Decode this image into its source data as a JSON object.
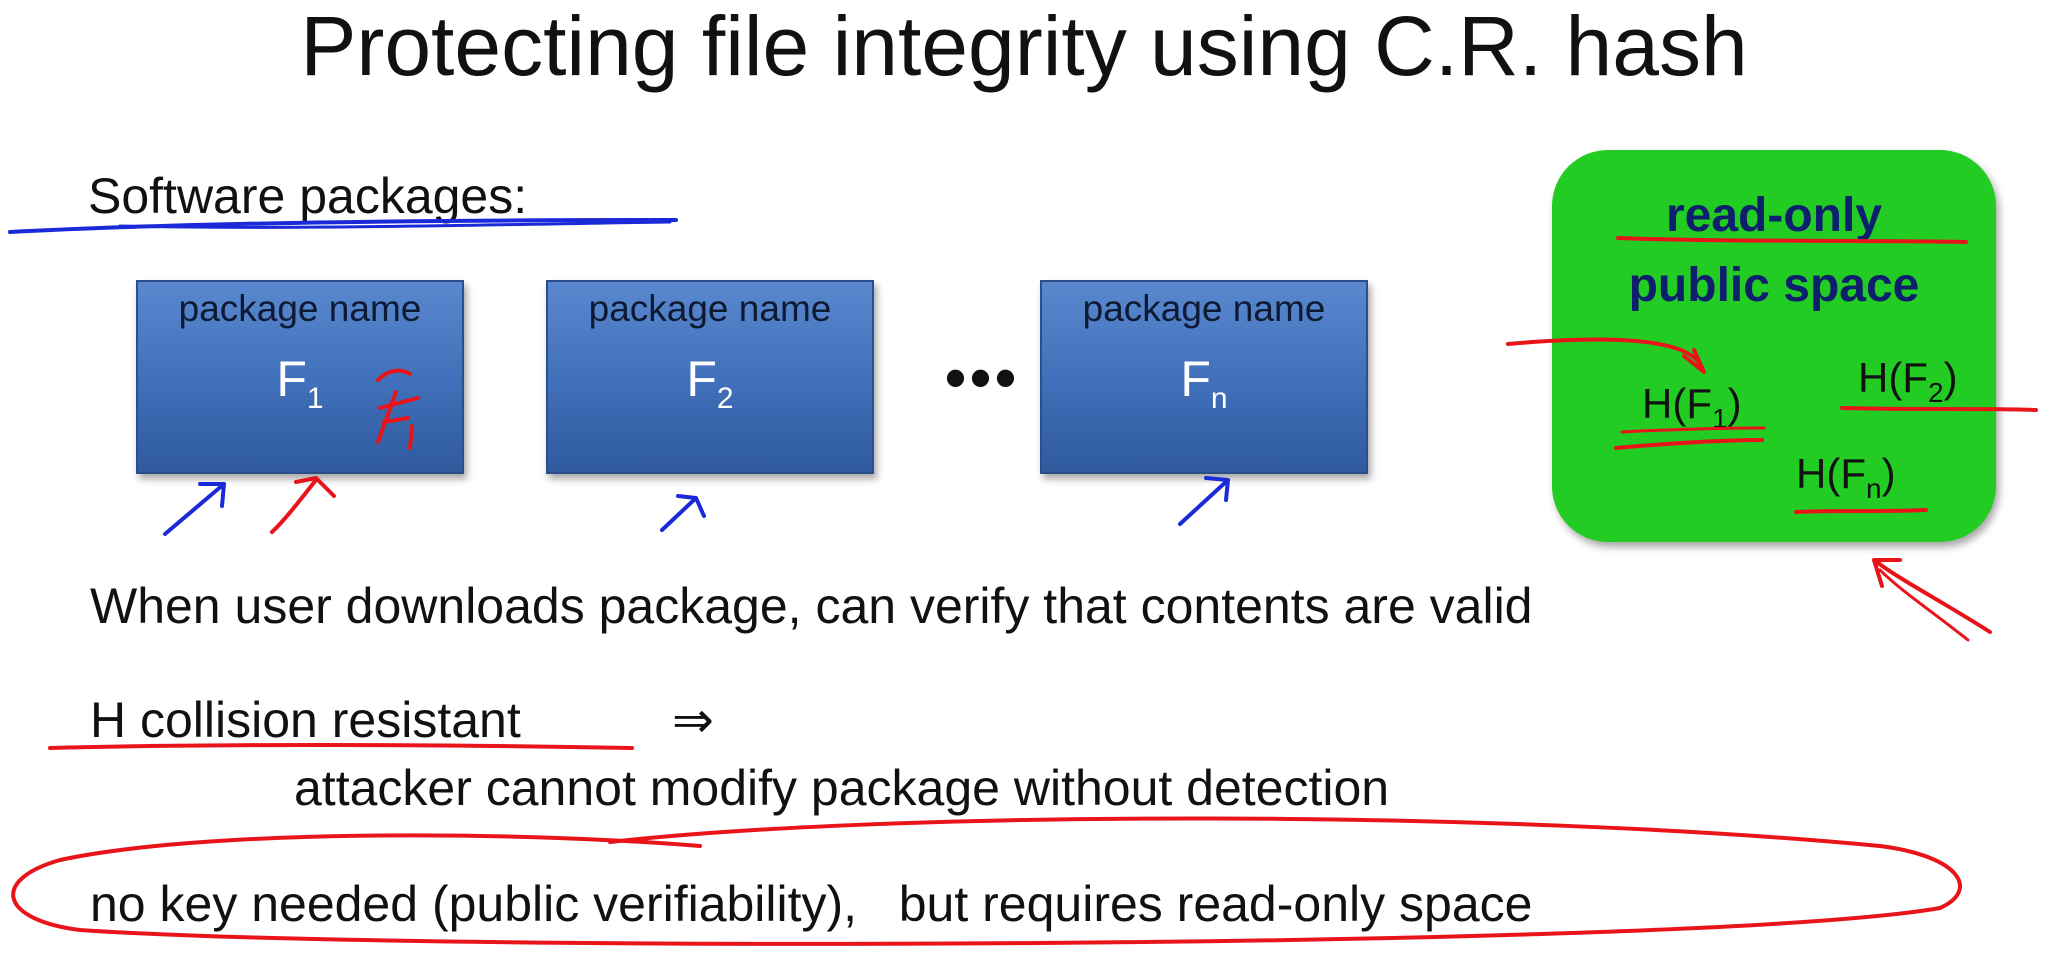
{
  "slide": {
    "title": "Protecting file integrity using C.R. hash",
    "heading": "Software packages:",
    "packages": [
      {
        "name": "package name",
        "file": "F",
        "sub": "1"
      },
      {
        "name": "package name",
        "file": "F",
        "sub": "2"
      },
      {
        "name": "package name",
        "file": "F",
        "sub": "n"
      }
    ],
    "ellipsis": "•••",
    "readonly_space": {
      "line1": "read-only",
      "line2": "public space",
      "hashes": [
        {
          "prefix": "H(F",
          "sub": "1",
          "suffix": ")"
        },
        {
          "prefix": "H(F",
          "sub": "2",
          "suffix": ")"
        },
        {
          "prefix": "H(F",
          "sub": "n",
          "suffix": ")"
        }
      ]
    },
    "verify_line": "When user downloads package, can verify that contents are valid",
    "collision_term": "H collision resistant",
    "implies": "⇒",
    "consequence": "attacker cannot modify package without detection",
    "conclusion": "no key needed (public verifiability),   but requires read-only space"
  },
  "colors": {
    "package_blue": "#4472c4",
    "space_green": "#22cc22",
    "ink_red": "#e8141a",
    "ink_blue": "#1a2ad8",
    "title_dark_blue": "#0e1f6e"
  }
}
